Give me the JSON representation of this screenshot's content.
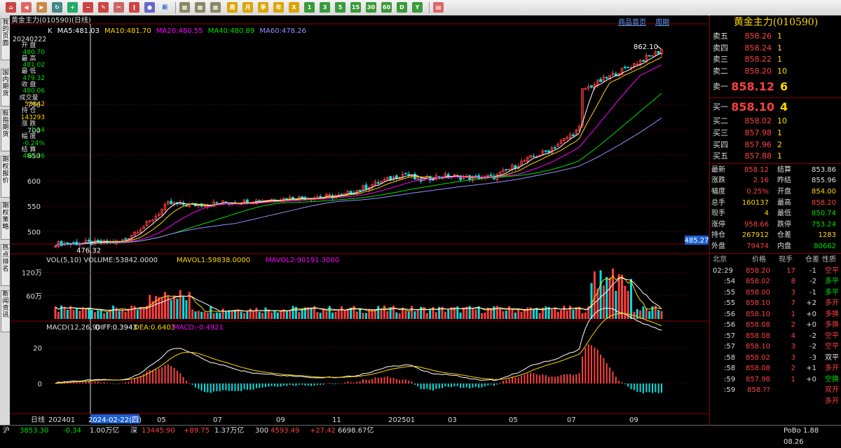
{
  "toolbar": {
    "icons": [
      "home-icon",
      "back-icon",
      "forward-icon",
      "refresh-icon",
      "zoom-in-icon",
      "zoom-out-icon",
      "draw-icon",
      "tools-icon",
      "indicator-icon",
      "news-icon"
    ],
    "new_label": "新",
    "period_buttons": [
      "周",
      "月",
      "季",
      "年",
      "X",
      "1",
      "3",
      "5",
      "15",
      "30",
      "60",
      "D",
      "Y"
    ]
  },
  "sidebar": {
    "tabs": [
      "我的页面",
      "国内期货",
      "股指期货",
      "期权报价",
      "期权策略",
      "热点排名",
      "新闻资讯"
    ]
  },
  "chart": {
    "title": "黄金主力(010590)(日线)",
    "links": [
      "商品首页",
      "周期"
    ],
    "ma": {
      "k": "K",
      "ma5": "MA5:481.03",
      "ma10": "MA10:481.70",
      "ma20": "MA20:480.55",
      "ma40": "MA40:480.89",
      "ma60": "MA60:478.26"
    },
    "ma_colors": {
      "ma5": "#ffffff",
      "ma10": "#ffd700",
      "ma20": "#ff00ff",
      "ma40": "#00e000",
      "ma60": "#9090ff"
    },
    "info": {
      "date": "20240222",
      "rows": [
        {
          "label": "开 盘",
          "value": "480.70",
          "color": "green"
        },
        {
          "label": "最 高",
          "value": "481.02",
          "color": "green"
        },
        {
          "label": "最 低",
          "value": "479.32",
          "color": "green"
        },
        {
          "label": "收 盘",
          "value": "480.06",
          "color": "green"
        },
        {
          "label": "成交量",
          "value": "53842",
          "color": "yellow"
        },
        {
          "label": "持 仓",
          "value": "143293",
          "color": "yellow"
        },
        {
          "label": "涨 跌",
          "value": "-1.14",
          "color": "green"
        },
        {
          "label": "幅 度",
          "value": "-0.24%",
          "color": "green"
        },
        {
          "label": "结 算",
          "value": "480.16",
          "color": "green"
        }
      ]
    },
    "price_axis": [
      "750",
      "700",
      "650",
      "600",
      "550",
      "500"
    ],
    "high_label": "862.10",
    "low_label": "476.32",
    "current_price_box": "485.27",
    "volume": {
      "title": "VOL(5,10) VOLUME:53842.0000",
      "mavol1": "MAVOL1:59838.0000",
      "mavol2": "MAVOL2:90191.3000",
      "ticks": [
        "120万",
        "60万"
      ]
    },
    "macd": {
      "title": "MACD(12,26,9)",
      "diff": "DIFF:0.3943",
      "dea": "DEA:0.6403",
      "macd": "MACD:-0.4921",
      "ticks": [
        "20",
        "0"
      ]
    },
    "x_axis": {
      "period": "日线",
      "labels": [
        "202401",
        "2024-02-22(四)",
        "05",
        "07",
        "09",
        "11",
        "202501",
        "03",
        "05",
        "07",
        "09"
      ]
    }
  },
  "chart_data": {
    "type": "line",
    "title": "黄金主力(010590)(日线)",
    "x": [
      "202401",
      "03",
      "05",
      "07",
      "09",
      "11",
      "202501",
      "03",
      "05",
      "07",
      "09"
    ],
    "series": [
      {
        "name": "MA5",
        "values": [
          476,
          485,
          560,
          565,
          580,
          620,
          640,
          690,
          790,
          775,
          860
        ]
      }
    ],
    "ylim": [
      470,
      870
    ]
  },
  "right_panel": {
    "title": "黄金主力(010590)",
    "asks": [
      {
        "label": "卖五",
        "price": "858.26",
        "vol": "1"
      },
      {
        "label": "卖四",
        "price": "858.24",
        "vol": "1"
      },
      {
        "label": "卖三",
        "price": "858.22",
        "vol": "1"
      },
      {
        "label": "卖二",
        "price": "858.20",
        "vol": "10"
      },
      {
        "label": "卖一",
        "price": "858.12",
        "vol": "6"
      }
    ],
    "bids": [
      {
        "label": "买一",
        "price": "858.10",
        "vol": "4"
      },
      {
        "label": "买二",
        "price": "858.02",
        "vol": "10"
      },
      {
        "label": "买三",
        "price": "857.98",
        "vol": "1"
      },
      {
        "label": "买四",
        "price": "857.96",
        "vol": "2"
      },
      {
        "label": "买五",
        "price": "857.88",
        "vol": "1"
      }
    ],
    "stats": [
      {
        "l1": "最新",
        "v1": "858.12",
        "c1": "red",
        "l2": "结算",
        "v2": "853.86",
        "c2": "white"
      },
      {
        "l1": "涨跌",
        "v1": "2.16",
        "c1": "red",
        "l2": "昨结",
        "v2": "855.96",
        "c2": "white"
      },
      {
        "l1": "幅度",
        "v1": "0.25%",
        "c1": "red",
        "l2": "开盘",
        "v2": "854.00",
        "c2": "yellow"
      },
      {
        "l1": "总手",
        "v1": "160137",
        "c1": "yellow",
        "l2": "最高",
        "v2": "858.20",
        "c2": "red"
      },
      {
        "l1": "现手",
        "v1": "4",
        "c1": "yellow",
        "l2": "最低",
        "v2": "850.74",
        "c2": "green"
      },
      {
        "l1": "涨停",
        "v1": "958.66",
        "c1": "red",
        "l2": "跌停",
        "v2": "753.24",
        "c2": "green"
      },
      {
        "l1": "持仓",
        "v1": "267912",
        "c1": "yellow",
        "l2": "仓差",
        "v2": "1283",
        "c2": "yellow"
      },
      {
        "l1": "外盘",
        "v1": "79474",
        "c1": "red",
        "l2": "内盘",
        "v2": "80662",
        "c2": "green"
      }
    ],
    "tick_headers": [
      "北京",
      "价格",
      "现手",
      "仓差",
      "性质"
    ],
    "ticks": [
      {
        "t": "02:29",
        "p": "858.20",
        "v": "17",
        "d": "-1",
        "n": "空平",
        "pc": "red",
        "nc": "red"
      },
      {
        "t": ":54",
        "p": "858.02",
        "v": "8",
        "d": "-2",
        "n": "多平",
        "pc": "red",
        "nc": "green"
      },
      {
        "t": ":55",
        "p": "858.00",
        "v": "3",
        "d": "-1",
        "n": "多平",
        "pc": "red",
        "nc": "green"
      },
      {
        "t": ":55",
        "p": "858.10",
        "v": "7",
        "d": "+2",
        "n": "多开",
        "pc": "red",
        "nc": "red"
      },
      {
        "t": ":56",
        "p": "858.10",
        "v": "1",
        "d": "+0",
        "n": "多换",
        "pc": "red",
        "nc": "red"
      },
      {
        "t": ":56",
        "p": "858.08",
        "v": "2",
        "d": "+0",
        "n": "多换",
        "pc": "red",
        "nc": "red"
      },
      {
        "t": ":57",
        "p": "858.08",
        "v": "4",
        "d": "-2",
        "n": "空平",
        "pc": "red",
        "nc": "red"
      },
      {
        "t": ":57",
        "p": "858.10",
        "v": "3",
        "d": "-2",
        "n": "空平",
        "pc": "red",
        "nc": "red"
      },
      {
        "t": ":58",
        "p": "858.02",
        "v": "3",
        "d": "-3",
        "n": "双平",
        "pc": "red",
        "nc": "white"
      },
      {
        "t": ":58",
        "p": "858.08",
        "v": "2",
        "d": "+1",
        "n": "多开",
        "pc": "red",
        "nc": "red"
      },
      {
        "t": ":59",
        "p": "857.98",
        "v": "1",
        "d": "+0",
        "n": "空换",
        "pc": "red",
        "nc": "green"
      },
      {
        "t": ":59",
        "p": "858.??",
        "v": "",
        "d": "",
        "n": "双开",
        "pc": "red",
        "nc": "red"
      },
      {
        "t": "",
        "p": "",
        "v": "",
        "d": "",
        "n": "多开",
        "pc": "red",
        "nc": "red"
      }
    ]
  },
  "statusbar": {
    "sh_label": "沪",
    "sh_index": "3853.30",
    "sh_chg": "-0.34",
    "sh_amt": "1.00万亿",
    "sz_label": "深",
    "sz_index": "13445.90",
    "sz_chg": "+89.75",
    "sz_amt": "1.37万亿",
    "c_label": "300",
    "c_index": "4593.49",
    "c_chg": "+27.42",
    "c_amt": "6698.67亿",
    "right": "PoBo 1.88 08.26"
  }
}
